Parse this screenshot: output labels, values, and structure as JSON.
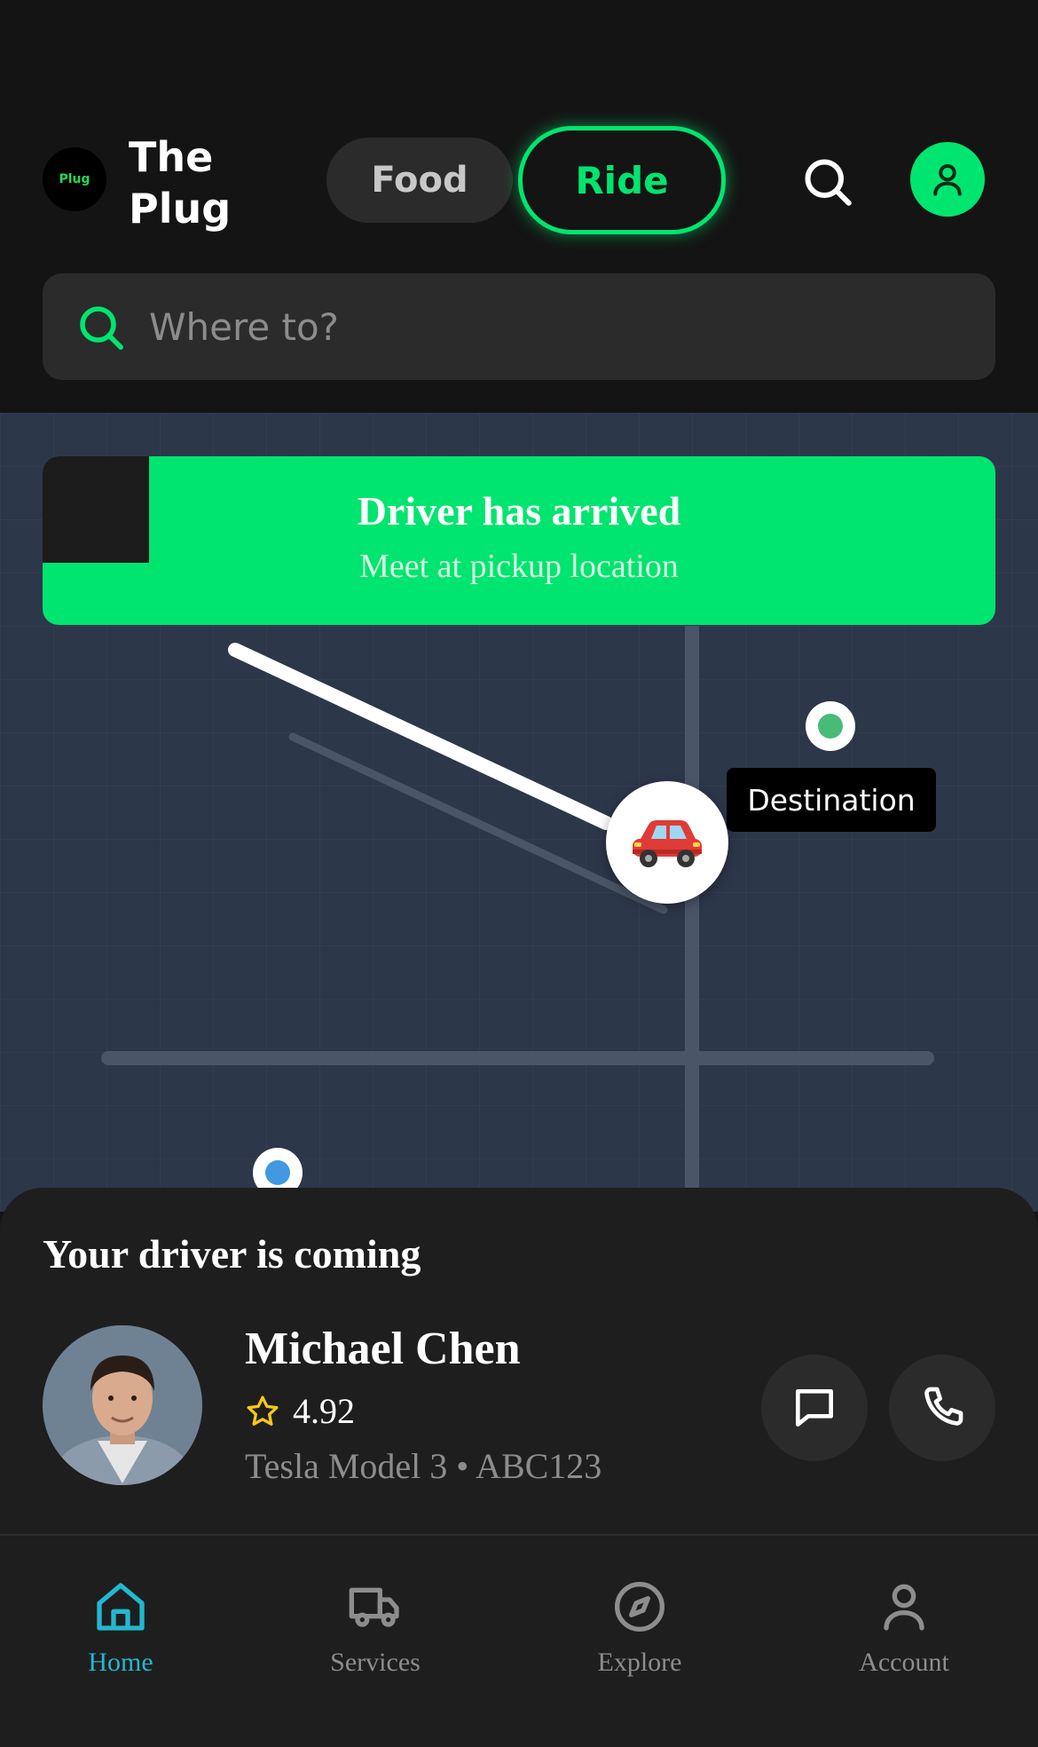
{
  "header": {
    "logo_text": "Plug",
    "brand_name": "The Plug",
    "tabs": [
      {
        "label": "Food",
        "active": false
      },
      {
        "label": "Ride",
        "active": true
      }
    ],
    "search_icon": "search-icon",
    "profile_icon": "user-icon",
    "accent_color": "#00e56f"
  },
  "search": {
    "placeholder": "Where to?"
  },
  "map": {
    "banner": {
      "title": "Driver has arrived",
      "subtitle": "Meet at pickup location"
    },
    "destination_label": "Destination",
    "car_marker_icon": "car-icon",
    "destination_color": "#48bb78",
    "pickup_color": "#4299e1"
  },
  "driver_sheet": {
    "title": "Your driver is coming",
    "driver": {
      "name": "Michael Chen",
      "rating": "4.92",
      "vehicle": "Tesla Model 3 • ABC123"
    },
    "actions": [
      {
        "name": "message-button",
        "icon": "message-icon"
      },
      {
        "name": "call-button",
        "icon": "phone-icon"
      }
    ]
  },
  "nav": {
    "items": [
      {
        "label": "Home",
        "icon": "home-icon",
        "active": true
      },
      {
        "label": "Services",
        "icon": "truck-icon",
        "active": false
      },
      {
        "label": "Explore",
        "icon": "compass-icon",
        "active": false
      },
      {
        "label": "Account",
        "icon": "user-icon",
        "active": false
      }
    ]
  }
}
